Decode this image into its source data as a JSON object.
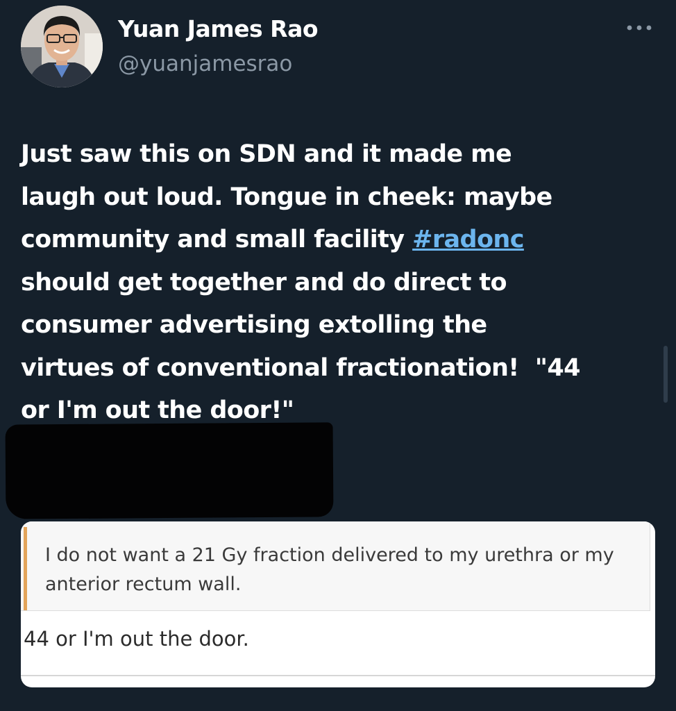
{
  "user": {
    "display_name": "Yuan James Rao",
    "handle": "@yuanjamesrao",
    "avatar_icon": "profile-photo"
  },
  "more_icon": "more-options-icon",
  "tweet": {
    "text_before": "Just saw this on SDN and it made me\nlaugh out loud. Tongue in cheek: maybe\ncommunity and small facility ",
    "hashtag": "#radonc",
    "text_after": "\nshould get together and do direct to\nconsumer advertising extolling the\nvirtues of conventional fractionation!  \"44\nor I'm out the door!\""
  },
  "embedded_image": {
    "quoted_text": "I do not want a 21 Gy fraction delivered to my urethra or my anterior rectum wall.",
    "reply_text": "44 or I'm out the door."
  },
  "colors": {
    "background": "#15202b",
    "hashtag": "#6cb5ee",
    "secondary_text": "#8b98a5",
    "quote_accent": "#e3a45a"
  }
}
